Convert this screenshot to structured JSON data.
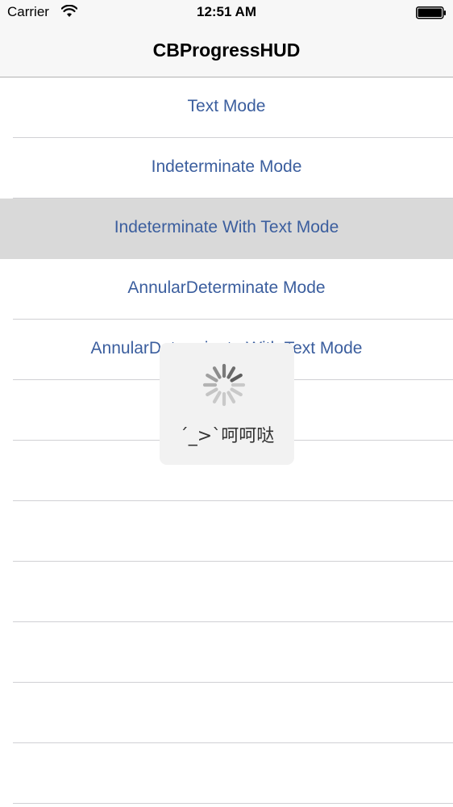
{
  "status_bar": {
    "carrier": "Carrier",
    "time": "12:51 AM",
    "wifi_icon": "wifi-icon",
    "battery_icon": "battery-icon"
  },
  "nav": {
    "title": "CBProgressHUD"
  },
  "table": {
    "rows": [
      {
        "label": "Text Mode"
      },
      {
        "label": "Indeterminate Mode"
      },
      {
        "label": "Indeterminate With Text Mode",
        "selected": true
      },
      {
        "label": "AnnularDeterminate Mode"
      },
      {
        "label": "AnnularDeterminate With Text Mode"
      }
    ]
  },
  "hud": {
    "spinner_icon": "activity-spinner-icon",
    "label": "´_>`呵呵哒"
  },
  "colors": {
    "link": "#3b5e9e",
    "selected_row": "#d9d9d9",
    "bar_background": "#f7f7f7"
  }
}
